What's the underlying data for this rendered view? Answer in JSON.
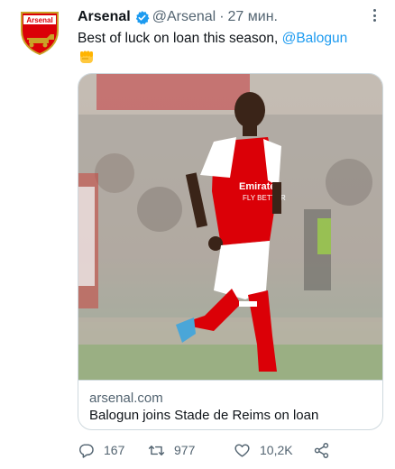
{
  "tweet": {
    "author_name": "Arsenal",
    "author_handle": "@Arsenal",
    "separator": "·",
    "time": "27 мин.",
    "text_prefix": "Best of luck on loan this season, ",
    "mention": "@Balogun",
    "emoji": "fist-emoji",
    "avatar_crest_text": "Arsenal"
  },
  "card": {
    "domain": "arsenal.com",
    "title": "Balogun joins Stade de Reims on loan",
    "image_sponsor_text": "Emirates FLY BETTER"
  },
  "actions": {
    "reply_count": "167",
    "retweet_count": "977",
    "like_count": "10,2K"
  },
  "colors": {
    "accent": "#1d9bf0",
    "text": "#0f1419",
    "muted": "#536471",
    "border": "#cfd9de",
    "arsenal_red": "#db0007"
  }
}
